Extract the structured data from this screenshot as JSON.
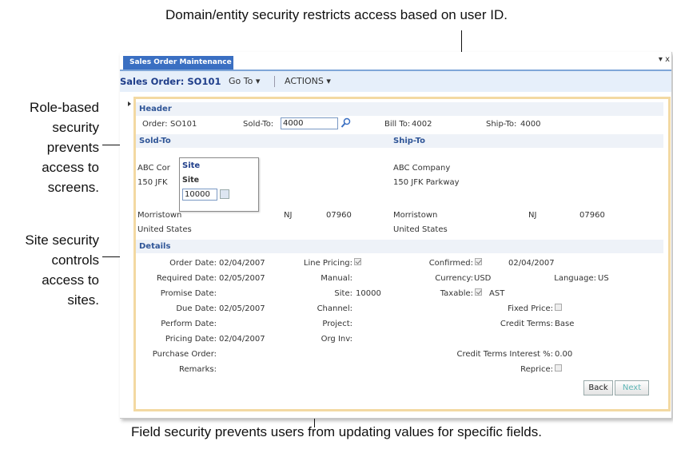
{
  "callouts": {
    "top": "Domain/entity security restricts access based on user ID.",
    "role": [
      "Role-based",
      "security",
      "prevents",
      "access to",
      "screens."
    ],
    "site": [
      "Site security",
      "controls",
      "access to",
      "sites."
    ],
    "bottom": "Field security prevents users from updating values for specific fields."
  },
  "window": {
    "tab_label": "Sales Order Maintenance",
    "pin_glyph": "▾ x",
    "title": "Sales Order: SO101",
    "goto_label": "Go To ▾",
    "actions_label": "ACTIONS ▾"
  },
  "header": {
    "section": "Header",
    "order_label": "Order:",
    "order_value": "SO101",
    "soldto_label": "Sold-To:",
    "soldto_value": "4000",
    "billto_label": "Bill To:",
    "billto_value": "4002",
    "shipto_label": "Ship-To:",
    "shipto_value": "4000"
  },
  "soldto": {
    "section": "Sold-To",
    "name": "ABC Cor",
    "street": "150 JFK",
    "city": "Morristown",
    "state": "NJ",
    "zip": "07960",
    "country": "United States"
  },
  "shipto": {
    "section": "Ship-To",
    "name": "ABC Company",
    "street": "150 JFK Parkway",
    "city": "Morristown",
    "state": "NJ",
    "zip": "07960",
    "country": "United States"
  },
  "site_popup": {
    "title": "Site",
    "label": "Site",
    "value": "10000"
  },
  "details": {
    "section": "Details",
    "order_date_label": "Order Date:",
    "order_date": "02/04/2007",
    "required_date_label": "Required Date:",
    "required_date": "02/05/2007",
    "promise_date_label": "Promise Date:",
    "due_date_label": "Due Date:",
    "due_date": "02/05/2007",
    "perform_date_label": "Perform Date:",
    "pricing_date_label": "Pricing Date:",
    "pricing_date": "02/04/2007",
    "purchase_order_label": "Purchase Order:",
    "remarks_label": "Remarks:",
    "line_pricing_label": "Line Pricing:",
    "manual_label": "Manual:",
    "site_label": "Site:",
    "site_value": "10000",
    "channel_label": "Channel:",
    "project_label": "Project:",
    "org_inv_label": "Org Inv:",
    "confirmed_label": "Confirmed:",
    "confirmed_date": "02/04/2007",
    "currency_label": "Currency:",
    "currency_value": "USD",
    "language_label": "Language:",
    "language_value": "US",
    "taxable_label": "Taxable:",
    "taxable_value": "AST",
    "fixed_price_label": "Fixed Price:",
    "credit_terms_label": "Credit Terms:",
    "credit_terms_value": "Base",
    "credit_interest_label": "Credit Terms Interest %:",
    "credit_interest_value": "0.00",
    "reprice_label": "Reprice:"
  },
  "buttons": {
    "back": "Back",
    "next": "Next"
  },
  "colors": {
    "accent": "#3a6fc2",
    "toolbar_bg": "#e6effa",
    "panel_border": "#f3d9a2",
    "next_text": "#5fb7b7"
  }
}
